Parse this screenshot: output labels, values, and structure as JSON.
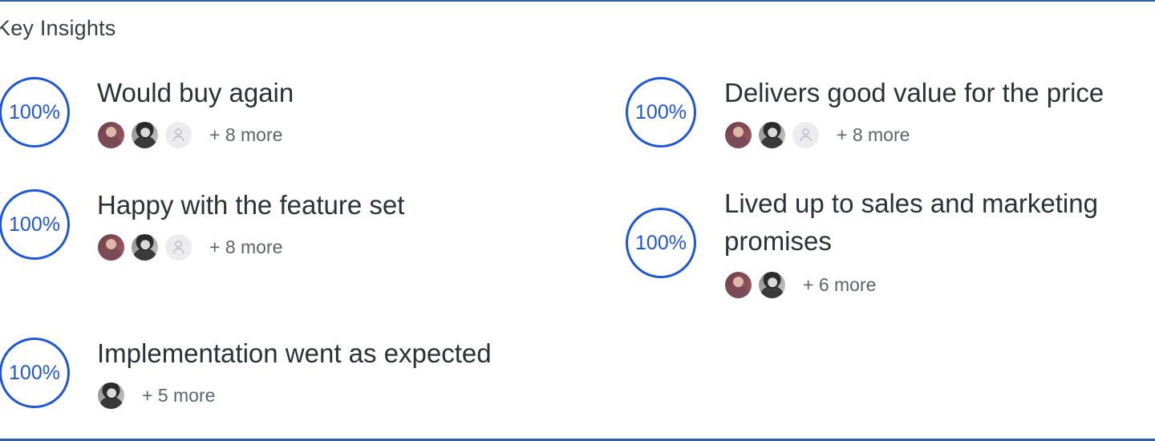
{
  "section": {
    "title": "Key Insights"
  },
  "insights": [
    {
      "percent": "100%",
      "label": "Would buy again",
      "more": "+ 8 more"
    },
    {
      "percent": "100%",
      "label": "Delivers good value for the price",
      "more": "+ 8 more"
    },
    {
      "percent": "100%",
      "label": "Happy with the feature set",
      "more": "+ 8 more"
    },
    {
      "percent": "100%",
      "label_line1": "Lived up to sales and marketing",
      "label_line2": "promises",
      "more": "+ 6 more"
    },
    {
      "percent": "100%",
      "label": "Implementation went as expected",
      "more": "+ 5 more"
    }
  ],
  "colors": {
    "accent": "#1f56d8",
    "frame": "#2f5f9e",
    "text": "#2d3136",
    "muted": "#5f646b"
  },
  "icons": {
    "placeholder_avatar": "person-icon"
  }
}
